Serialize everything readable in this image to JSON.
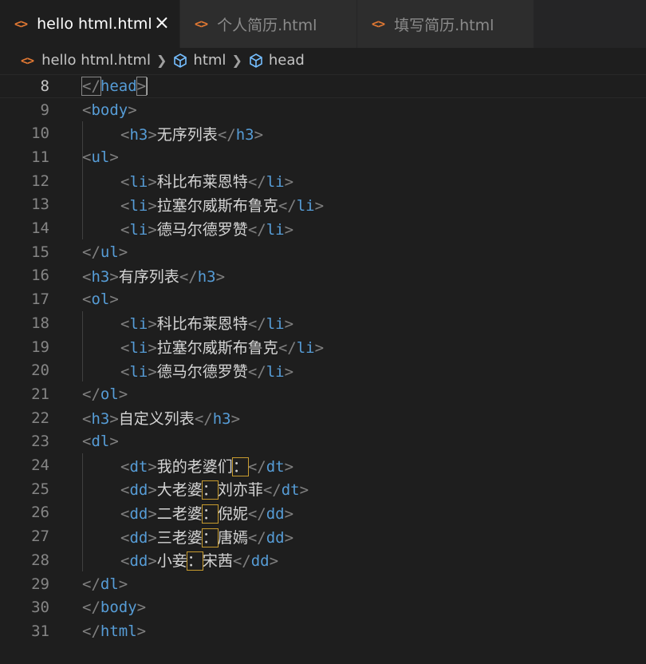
{
  "tabs": [
    {
      "label": "hello html.html",
      "active": true
    },
    {
      "label": "个人简历.html",
      "active": false
    },
    {
      "label": "填写简历.html",
      "active": false
    }
  ],
  "tab_close": "×",
  "breadcrumb": {
    "file": "hello html.html",
    "items": [
      "html",
      "head"
    ]
  },
  "lines": [
    {
      "num": "8",
      "indent": 0,
      "open": "</",
      "tag": "head",
      "close": ">",
      "text": "",
      "current": true
    },
    {
      "num": "9",
      "indent": 0,
      "open": "<",
      "tag": "body",
      "close": ">",
      "text": ""
    },
    {
      "num": "10",
      "indent": 1,
      "open": "<",
      "tag": "h3",
      "close": ">",
      "text": "无序列表",
      "etag": "h3"
    },
    {
      "num": "11",
      "indent": 0,
      "open": "<",
      "tag": "ul",
      "close": ">",
      "text": ""
    },
    {
      "num": "12",
      "indent": 1,
      "open": "<",
      "tag": "li",
      "close": ">",
      "text": "科比布莱恩特",
      "etag": "li"
    },
    {
      "num": "13",
      "indent": 1,
      "open": "<",
      "tag": "li",
      "close": ">",
      "text": "拉塞尔威斯布鲁克",
      "etag": "li"
    },
    {
      "num": "14",
      "indent": 1,
      "open": "<",
      "tag": "li",
      "close": ">",
      "text": "德马尔德罗赞",
      "etag": "li"
    },
    {
      "num": "15",
      "indent": 0,
      "open": "</",
      "tag": "ul",
      "close": ">",
      "text": ""
    },
    {
      "num": "16",
      "indent": 0,
      "open": "<",
      "tag": "h3",
      "close": ">",
      "text": "有序列表",
      "etag": "h3"
    },
    {
      "num": "17",
      "indent": 0,
      "open": "<",
      "tag": "ol",
      "close": ">",
      "text": ""
    },
    {
      "num": "18",
      "indent": 1,
      "open": "<",
      "tag": "li",
      "close": ">",
      "text": "科比布莱恩特",
      "etag": "li"
    },
    {
      "num": "19",
      "indent": 1,
      "open": "<",
      "tag": "li",
      "close": ">",
      "text": "拉塞尔威斯布鲁克",
      "etag": "li"
    },
    {
      "num": "20",
      "indent": 1,
      "open": "<",
      "tag": "li",
      "close": ">",
      "text": "德马尔德罗赞",
      "etag": "li"
    },
    {
      "num": "21",
      "indent": 0,
      "open": "</",
      "tag": "ol",
      "close": ">",
      "text": ""
    },
    {
      "num": "22",
      "indent": 0,
      "open": "<",
      "tag": "h3",
      "close": ">",
      "text": "自定义列表",
      "etag": "h3"
    },
    {
      "num": "23",
      "indent": 0,
      "open": "<",
      "tag": "dl",
      "close": ">",
      "text": ""
    },
    {
      "num": "24",
      "indent": 1,
      "open": "<",
      "tag": "dt",
      "close": ">",
      "text": "我的老婆们",
      "colon": "：",
      "after": "",
      "etag": "dt"
    },
    {
      "num": "25",
      "indent": 1,
      "open": "<",
      "tag": "dd",
      "close": ">",
      "text": "大老婆",
      "colon": "：",
      "after": "刘亦菲",
      "etag": "dt"
    },
    {
      "num": "26",
      "indent": 1,
      "open": "<",
      "tag": "dd",
      "close": ">",
      "text": "二老婆",
      "colon": "：",
      "after": "倪妮",
      "etag": "dd"
    },
    {
      "num": "27",
      "indent": 1,
      "open": "<",
      "tag": "dd",
      "close": ">",
      "text": "三老婆",
      "colon": "：",
      "after": "唐嫣",
      "etag": "dd"
    },
    {
      "num": "28",
      "indent": 1,
      "open": "<",
      "tag": "dd",
      "close": ">",
      "text": "小妾",
      "colon": "：",
      "after": "宋茜",
      "etag": "dd"
    },
    {
      "num": "29",
      "indent": 0,
      "open": "</",
      "tag": "dl",
      "close": ">",
      "text": ""
    },
    {
      "num": "30",
      "indent": 0,
      "open": "</",
      "tag": "body",
      "close": ">",
      "text": ""
    },
    {
      "num": "31",
      "indent": 0,
      "open": "</",
      "tag": "html",
      "close": ">",
      "text": ""
    }
  ],
  "colors": {
    "tag": "#569cd6",
    "bracket": "#808080",
    "text": "#d4d4d4",
    "icon": "#e37933",
    "highlight": "#c79b2e"
  }
}
